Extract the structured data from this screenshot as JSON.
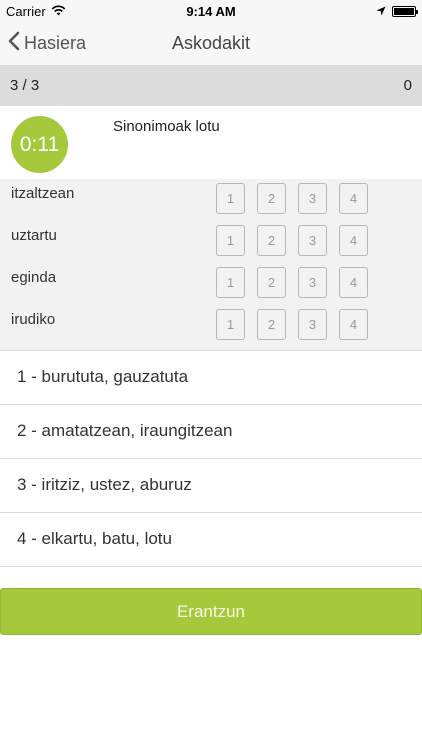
{
  "status_bar": {
    "carrier": "Carrier",
    "time": "9:14 AM",
    "battery_level": 1.0
  },
  "nav": {
    "back_label": "Hasiera",
    "title": "Askodakit"
  },
  "progress": {
    "question_counter": "3 / 3",
    "score": "0"
  },
  "question": {
    "timer": "0:11",
    "title": "Sinonimoak lotu"
  },
  "match_rows": [
    {
      "word": "itzaltzean",
      "options": [
        "1",
        "2",
        "3",
        "4"
      ]
    },
    {
      "word": "uztartu",
      "options": [
        "1",
        "2",
        "3",
        "4"
      ]
    },
    {
      "word": "eginda",
      "options": [
        "1",
        "2",
        "3",
        "4"
      ]
    },
    {
      "word": "irudiko",
      "options": [
        "1",
        "2",
        "3",
        "4"
      ]
    }
  ],
  "answers": [
    "1 - burututa, gauzatuta",
    "2 - amatatzean, iraungitzean",
    "3 - iritziz, ustez, aburuz",
    "4 - elkartu, batu, lotu"
  ],
  "submit_label": "Erantzun",
  "colors": {
    "accent": "#a5c93b",
    "bar_background": "#f7f7f7",
    "progress_background": "#dcdcdc",
    "grid_background": "#f2f2f2"
  },
  "icons": {
    "wifi": "wifi-icon",
    "location": "location-arrow-icon",
    "battery": "battery-icon",
    "back": "chevron-left-icon"
  }
}
